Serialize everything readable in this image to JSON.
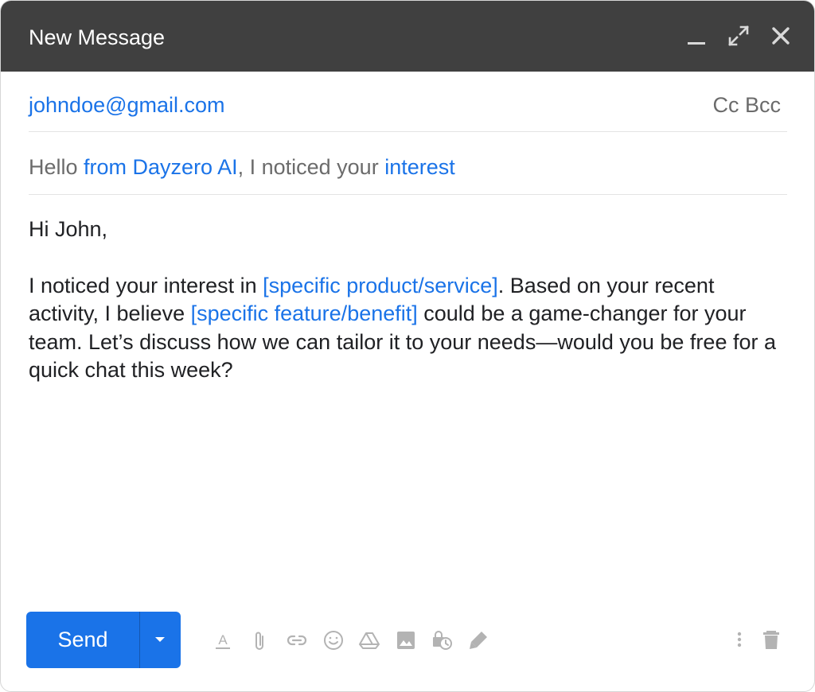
{
  "window": {
    "title": "New Message",
    "controls": [
      "minimize-icon",
      "expand-icon",
      "close-icon"
    ]
  },
  "recipients": {
    "to": "johndoe@gmail.com",
    "cc_label": "Cc",
    "bcc_label": "Bcc"
  },
  "subject": {
    "parts": [
      "Hello ",
      "from Dayzero AI",
      ", I noticed your ",
      "interest"
    ]
  },
  "body": {
    "greeting": "Hi John,",
    "p1_a": "I noticed your interest in ",
    "p1_placeholder1": "[specific product/service]",
    "p1_b": ". Based on your recent activity, I believe ",
    "p1_placeholder2": "[specific feature/benefit]",
    "p1_c": " could be a game-changer for your team. Let’s discuss how we can tailor it to your needs—would you be free for a quick chat this week?"
  },
  "footer": {
    "send_label": "Send",
    "tools": [
      "formatting-icon",
      "attach-icon",
      "link-icon",
      "emoji-icon",
      "drive-icon",
      "photo-icon",
      "confidential-icon",
      "signature-icon"
    ],
    "right_tools": [
      "more-options-icon",
      "discard-icon"
    ]
  },
  "colors": {
    "accent": "#1a73e8",
    "titlebar": "#404040",
    "muted_text": "#6b6b6b",
    "body_text": "#202124",
    "icon": "#b3b3b3"
  }
}
